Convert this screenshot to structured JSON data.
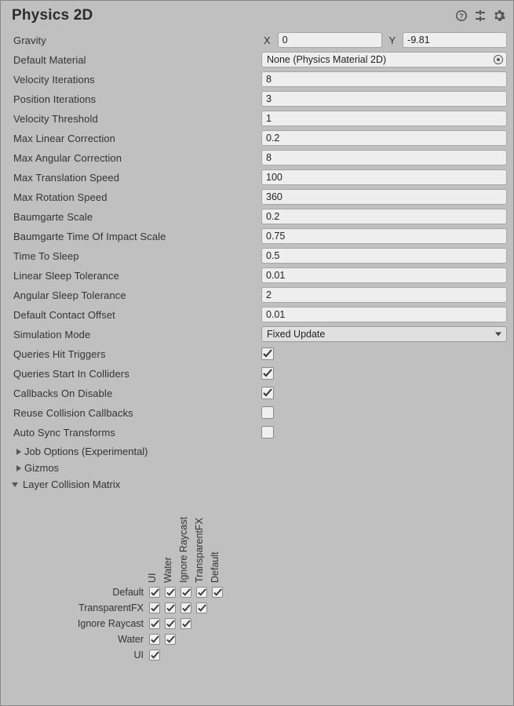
{
  "header": {
    "title": "Physics 2D"
  },
  "gravity": {
    "label": "Gravity",
    "x_label": "X",
    "y_label": "Y",
    "x": "0",
    "y": "-9.81"
  },
  "default_material": {
    "label": "Default Material",
    "value": "None (Physics Material 2D)"
  },
  "velocity_iterations": {
    "label": "Velocity Iterations",
    "value": "8"
  },
  "position_iterations": {
    "label": "Position Iterations",
    "value": "3"
  },
  "velocity_threshold": {
    "label": "Velocity Threshold",
    "value": "1"
  },
  "max_linear_correction": {
    "label": "Max Linear Correction",
    "value": "0.2"
  },
  "max_angular_correction": {
    "label": "Max Angular Correction",
    "value": "8"
  },
  "max_translation_speed": {
    "label": "Max Translation Speed",
    "value": "100"
  },
  "max_rotation_speed": {
    "label": "Max Rotation Speed",
    "value": "360"
  },
  "baumgarte_scale": {
    "label": "Baumgarte Scale",
    "value": "0.2"
  },
  "baumgarte_toi_scale": {
    "label": "Baumgarte Time Of Impact Scale",
    "value": "0.75"
  },
  "time_to_sleep": {
    "label": "Time To Sleep",
    "value": "0.5"
  },
  "linear_sleep_tolerance": {
    "label": "Linear Sleep Tolerance",
    "value": "0.01"
  },
  "angular_sleep_tolerance": {
    "label": "Angular Sleep Tolerance",
    "value": "2"
  },
  "default_contact_offset": {
    "label": "Default Contact Offset",
    "value": "0.01"
  },
  "simulation_mode": {
    "label": "Simulation Mode",
    "value": "Fixed Update"
  },
  "queries_hit_triggers": {
    "label": "Queries Hit Triggers",
    "checked": true
  },
  "queries_start_in_colliders": {
    "label": "Queries Start In Colliders",
    "checked": true
  },
  "callbacks_on_disable": {
    "label": "Callbacks On Disable",
    "checked": true
  },
  "reuse_collision_callbacks": {
    "label": "Reuse Collision Callbacks",
    "checked": false
  },
  "auto_sync_transforms": {
    "label": "Auto Sync Transforms",
    "checked": false
  },
  "foldouts": {
    "job_options": "Job Options (Experimental)",
    "gizmos": "Gizmos",
    "layer_matrix": "Layer Collision Matrix"
  },
  "matrix": {
    "rows": [
      "Default",
      "TransparentFX",
      "Ignore Raycast",
      "Water",
      "UI"
    ],
    "cols": [
      "Default",
      "TransparentFX",
      "Ignore Raycast",
      "Water",
      "UI"
    ],
    "checked_all": true
  }
}
